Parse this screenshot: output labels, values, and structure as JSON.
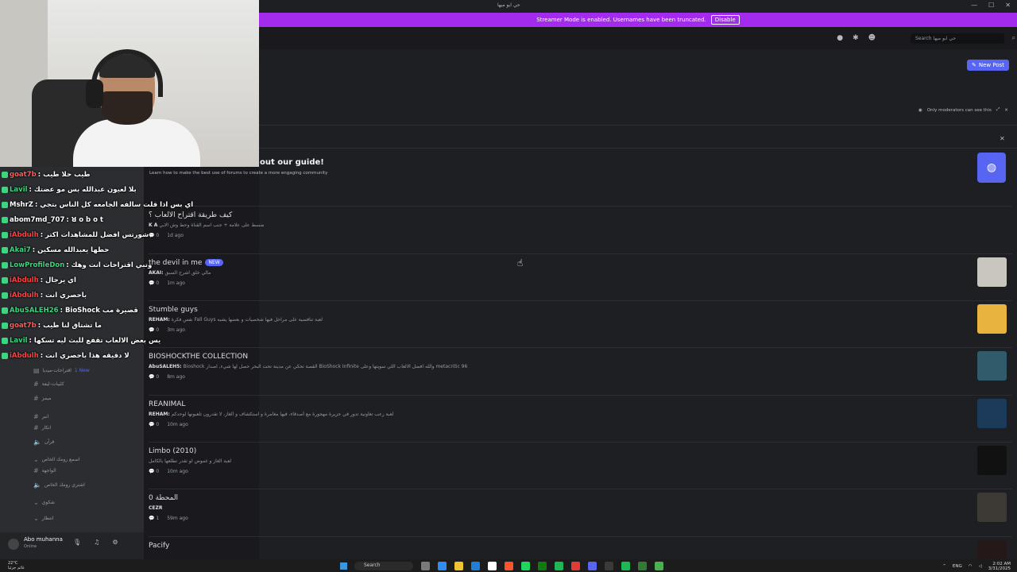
{
  "window": {
    "title": "حي ابو ميها",
    "min": "—",
    "max": "☐",
    "close": "✕"
  },
  "banner": {
    "text": "Streamer Mode is enabled. Usernames have been truncated.",
    "disable_label": "Disable"
  },
  "header": {
    "search_placeholder": "Search حي ابو ميها",
    "new_post_label": "New Post"
  },
  "modnote": "Only moderators can see this",
  "guide": {
    "title": "out our guide!",
    "subtitle": "Learn how to make the best use of forums to create a more engaging community"
  },
  "posts": [
    {
      "title": "كيف طريقة اقتراح الالعاب ؟",
      "tag": "",
      "author": "K A",
      "preview": "ضسط على علامة + جنب اسم القناة وحط وش الابي",
      "replies": "0",
      "time": "1d ago",
      "thumb_color": ""
    },
    {
      "title": "the devil in me",
      "tag": "NEW",
      "author": "AKAI:",
      "preview": "مالي خلق اشرح السبق",
      "replies": "0",
      "time": "1m ago",
      "thumb_color": "#c9c6c0"
    },
    {
      "title": "Stumble guys",
      "tag": "",
      "author": "REHAM:",
      "preview": "نفس فكرة Fall Guys لعبة تنافسية على مراحل فيها شخصيات و بعضها يشبه",
      "replies": "0",
      "time": "3m ago",
      "thumb_color": "#e9b340"
    },
    {
      "title": "BIOSHOCKTHE COLLECTION",
      "tag": "",
      "author": "AbuSALEH5:",
      "preview": "Bioshock القصة تحكي عن مدينة تحت البحر حصل لها شيء, اصدار BioShock Infinite والله افضل الالعاب اللي سويتها وعلى metacritic 96",
      "replies": "0",
      "time": "8m ago",
      "thumb_color": "#2f5b6b"
    },
    {
      "title": "REANIMAL",
      "tag": "",
      "author": "REHAM:",
      "preview": "لعبة رعب تعاونية تدور في جزيرة مهجورة مع أصدقاء، فيها مغامرة و استكشاف و ألغاز، لا تقدرون تلعبونها لوحدكم",
      "replies": "0",
      "time": "10m ago",
      "thumb_color": "#1c3b5a"
    },
    {
      "title": "Limbo (2010)",
      "tag": "",
      "author": "",
      "preview": "لعبة الغاز و غموض لو تقدر تطلعها بالكامل",
      "replies": "0",
      "time": "10m ago",
      "thumb_color": "#111111"
    },
    {
      "title": "المحطة 0",
      "tag": "",
      "author": "CEZR",
      "preview": "",
      "replies": "1",
      "time": "59m ago",
      "thumb_color": "#3d3a36"
    },
    {
      "title": "Pacify",
      "tag": "",
      "author": "",
      "preview": "",
      "replies": "",
      "time": "",
      "thumb_color": "#241818"
    }
  ],
  "chat": [
    {
      "user": "goat7b",
      "color": "#ff5c5c",
      "msg": ": طيب حلا طيب"
    },
    {
      "user": "Lavil",
      "color": "#3bd67f",
      "msg": ": بلا لعيون عبدالله بس مو عضتك"
    },
    {
      "user": "MshrZ",
      "color": "#ffffff",
      "msg": ": اي بس اذا قلت سالفه الجامعه كل الناس بتجي"
    },
    {
      "user": "abom7md_707",
      "color": "#ffffff",
      "msg": ": ꓤ o b o t"
    },
    {
      "user": "iAbdulh",
      "color": "#ff4040",
      "msg": ": شورتس افضل للمشاهدات اكتر"
    },
    {
      "user": "Akai7",
      "color": "#3bd67f",
      "msg": ": حطها يعبدالله مسكين"
    },
    {
      "user": "LowProfileDon",
      "color": "#3bd67f",
      "msg": ": وتبي اقتراحات انت وهك"
    },
    {
      "user": "iAbdulh",
      "color": "#ff4040",
      "msg": ": اي يرجال"
    },
    {
      "user": "iAbdulh",
      "color": "#ff4040",
      "msg": ": باحصري انت"
    },
    {
      "user": "AbuSALEH26",
      "color": "#3bd67f",
      "msg": ": BioShock قصيرة مب"
    },
    {
      "user": "goat7b",
      "color": "#ff5c5c",
      "msg": ": ما تشتاق لنا طيب"
    },
    {
      "user": "Lavil",
      "color": "#3bd67f",
      "msg": ": يس بعض الالعاب تقفع للبث ليه تسكها"
    },
    {
      "user": "iAbdulh",
      "color": "#ff4040",
      "msg": ": لا دقيقه هذا باحصري انت"
    }
  ],
  "channels": [
    {
      "label": "اقتراحات-ميديا",
      "badge": "1 New",
      "icon": "forum"
    },
    {
      "label": "كليبات-ليفة",
      "badge": "",
      "icon": "hash"
    },
    {
      "label": "ميمز",
      "badge": "",
      "icon": "hash"
    },
    {
      "label": "انبر",
      "badge": "",
      "icon": "hash"
    },
    {
      "label": "انكار",
      "badge": "",
      "icon": "hash"
    },
    {
      "label": "قرآن",
      "badge": "",
      "icon": "speaker"
    },
    {
      "label": "اسمع رومك الخاص",
      "badge": "",
      "icon": "category"
    },
    {
      "label": "الواجهة",
      "badge": "",
      "icon": "hash"
    },
    {
      "label": "اشتري رومك الخاص",
      "badge": "",
      "icon": "speaker"
    },
    {
      "label": "شكوي",
      "badge": "",
      "icon": "category"
    },
    {
      "label": "انتظار",
      "badge": "",
      "icon": "category"
    }
  ],
  "user": {
    "name": "Abo muhanna",
    "status": "Online"
  },
  "taskbar": {
    "weather_temp": "22°C",
    "weather_desc": "غائم جزئيا",
    "search_label": "Search",
    "lang": "ENG",
    "time": "2:02 AM",
    "date": "3/31/2025"
  },
  "colors": {
    "banner": "#a32bed",
    "accent": "#5865f2"
  }
}
